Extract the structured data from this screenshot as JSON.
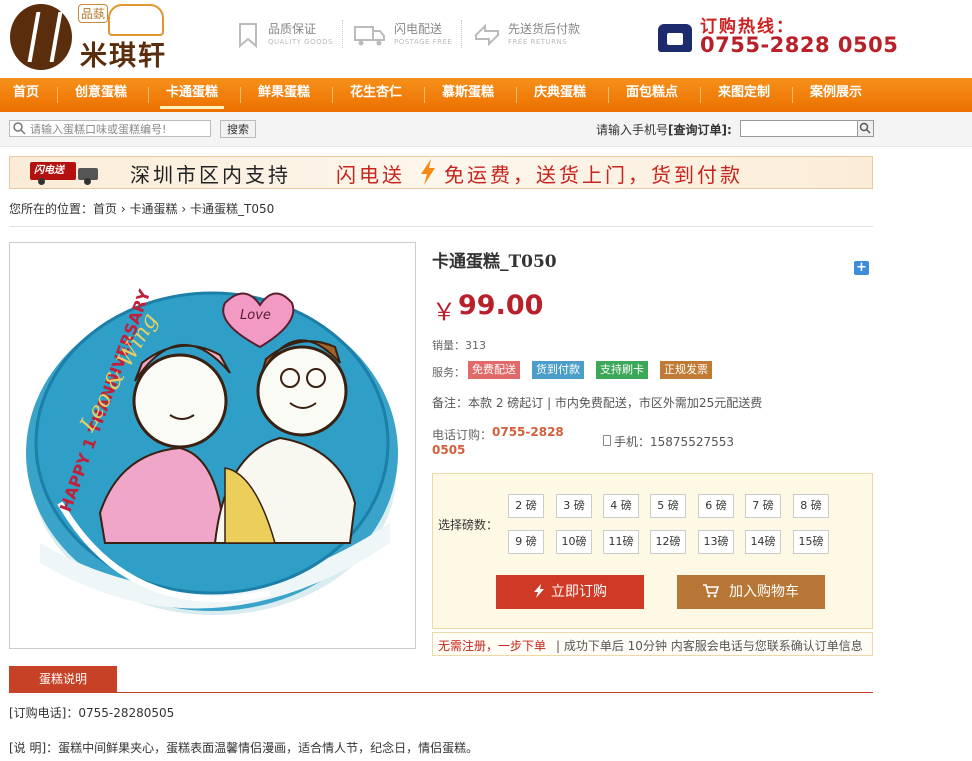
{
  "header": {
    "logo_text": "米琪轩",
    "logo_sub": "品蓺",
    "features": [
      {
        "icon": "bookmark-icon",
        "title": "品质保证",
        "sub": "QUALITY GOODS"
      },
      {
        "icon": "truck-icon",
        "title": "闪电配送",
        "sub": "POSTAGE FREE"
      },
      {
        "icon": "return-arrows-icon",
        "title": "先送货后付款",
        "sub": "FREE RETURNS"
      }
    ],
    "hotline_label": "订购热线：",
    "hotline_number": "0755-2828 0505"
  },
  "nav": {
    "items": [
      "首页",
      "创意蛋糕",
      "卡通蛋糕",
      "鲜果蛋糕",
      "花生杏仁",
      "慕斯蛋糕",
      "庆典蛋糕",
      "面包糕点",
      "来图定制",
      "案例展示"
    ],
    "active_index": 2
  },
  "search": {
    "placeholder": "请输入蛋糕口味或蛋糕编号!",
    "button": "搜索",
    "order_query_prefix": "请输入手机号",
    "order_query_label": "[查询订单]:"
  },
  "banner": {
    "truck_text": "闪电送",
    "text1": "深圳市区内支持",
    "text2": "闪电送",
    "text3": "免运费，送货上门，货到付款"
  },
  "breadcrumb": {
    "prefix": "您所在的位置：",
    "items": [
      "首页",
      "卡通蛋糕",
      "卡通蛋糕_T050"
    ]
  },
  "product": {
    "title": "卡通蛋糕_T050",
    "currency": "￥",
    "price": "99.00",
    "sales_label": "销量：",
    "sales": "313",
    "service_label": "服务：",
    "services": [
      {
        "label": "免费配送",
        "color": "#e06a6a"
      },
      {
        "label": "货到付款",
        "color": "#4a9ec9"
      },
      {
        "label": "支持刷卡",
        "color": "#3aa858"
      },
      {
        "label": "正规发票",
        "color": "#c07a34"
      }
    ],
    "note": "备注：本款 2 磅起订 | 市内免费配送，市区外需加25元配送费",
    "tel_label": "电话订购：",
    "tel_part1": "0755-2828",
    "tel_part2": "0505",
    "mobile_label": "手机：",
    "mobile": "15875527553",
    "image_texts": {
      "top": "HAPPY 1 THANNIVERSARY",
      "names": "Leo & Wing",
      "heart": "Love"
    }
  },
  "order": {
    "weight_label": "选择磅数：",
    "weights": [
      "2 磅",
      "3 磅",
      "4 磅",
      "5 磅",
      "6 磅",
      "7 磅",
      "8 磅",
      "9 磅",
      "10磅",
      "11磅",
      "12磅",
      "13磅",
      "14磅",
      "15磅"
    ],
    "buy_label": "立即订购",
    "cart_label": "加入购物车",
    "tip1": "无需注册，一步下单",
    "tip2": "| 成功下单后 10分钟 内客服会电话与您联系确认订单信息"
  },
  "description": {
    "tab": "蛋糕说明",
    "line1": "[订购电话]：0755-28280505",
    "line2": "[说 明]：蛋糕中间鲜果夹心，蛋糕表面温馨情侣漫画，适合情人节，纪念日，情侣蛋糕。"
  },
  "colors": {
    "nav": "#f08410",
    "accent": "#b8202a",
    "buy": "#cf3a26",
    "cart": "#b77636"
  }
}
